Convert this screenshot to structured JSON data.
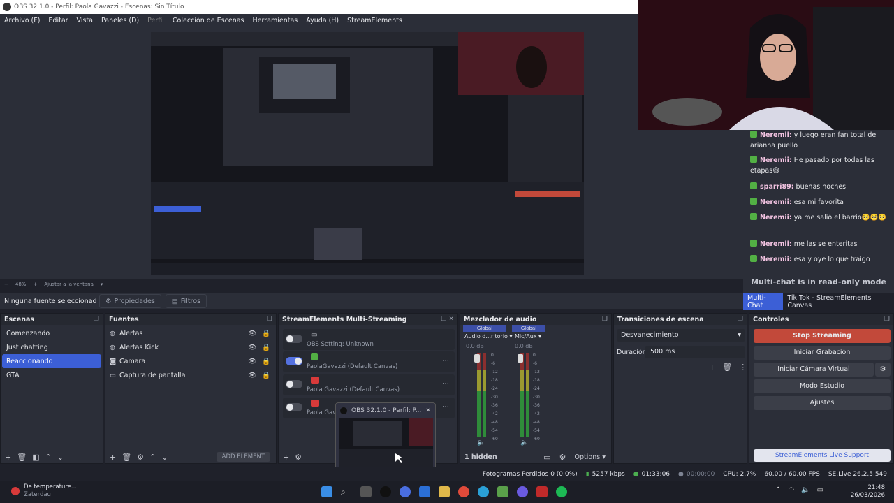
{
  "window": {
    "title": "OBS 32.1.0 - Perfil: Paola Gavazzi - Escenas: Sin Título"
  },
  "menu": [
    "Archivo (F)",
    "Editar",
    "Vista",
    "Paneles (D)",
    "Perfil",
    "Colección de Escenas",
    "Herramientas",
    "Ayuda (H)",
    "StreamElements"
  ],
  "zoom": {
    "level": "48%",
    "fit": "Ajustar a la ventana"
  },
  "propbar": {
    "no_source": "Ninguna fuente seleccionad",
    "properties": "Propiedades",
    "filters": "Filtros"
  },
  "chat": {
    "messages": [
      {
        "user": "Neremii:",
        "text": " y luego eran fan total de arianna puello"
      },
      {
        "user": "Neremii:",
        "text": " He pasado por todas las etapas😄"
      },
      {
        "user": "sparri89:",
        "text": " buenas noches"
      },
      {
        "user": "Neremii:",
        "text": " esa mi favorita"
      },
      {
        "user": "Neremii:",
        "text": " ya me salió el barrio🥺🥺🥺"
      },
      {
        "user": "Neremii:",
        "text": " me las se enteritas"
      },
      {
        "user": "Neremii:",
        "text": " esa y oye lo que traigo"
      }
    ],
    "readonly": "Multi-chat is in read-only mode",
    "tabs": [
      "Multi-Chat",
      "Tik Tok - StreamElements Canvas"
    ]
  },
  "scenes": {
    "title": "Escenas",
    "items": [
      "Comenzando",
      "Just chatting",
      "Reaccionando",
      "GTA"
    ],
    "selected": 2
  },
  "sources": {
    "title": "Fuentes",
    "items": [
      "Alertas",
      "Alertas Kick",
      "Camara",
      "Captura de pantalla"
    ],
    "add_element": "ADD ELEMENT"
  },
  "multistream": {
    "title": "StreamElements Multi-Streaming",
    "rows": [
      {
        "name": "OBS Setting: Unknown",
        "on": false
      },
      {
        "name": "PaolaGavazzi (Default Canvas)",
        "on": true
      },
      {
        "name": "Paola Gavazzi (Default Canvas)",
        "on": false
      },
      {
        "name": "Paola Gava",
        "on": false
      }
    ]
  },
  "mixer": {
    "title": "Mezclador de audio",
    "channels": [
      {
        "group": "Global",
        "name": "Audio d...ritorio",
        "db": "0.0 dB"
      },
      {
        "group": "Global",
        "name": "Mic/Aux",
        "db": "0.0 dB"
      }
    ],
    "scale": [
      "0",
      "-6",
      "-12",
      "-18",
      "-24",
      "-30",
      "-36",
      "-42",
      "-48",
      "-54",
      "-60"
    ],
    "hidden": "1 hidden",
    "options": "Options"
  },
  "transitions": {
    "title": "Transiciones de escena",
    "type": "Desvanecimiento",
    "duration_label": "Duración",
    "duration": "500 ms"
  },
  "controls": {
    "title": "Controles",
    "stop_streaming": "Stop Streaming",
    "start_recording": "Iniciar Grabación",
    "virtual_cam": "Iniciar Cámara Virtual",
    "studio_mode": "Modo Estudio",
    "settings": "Ajustes",
    "live_support": "StreamElements Live Support"
  },
  "status": {
    "dropped": "Fotogramas Perdidos 0 (0.0%)",
    "kbps": "5257 kbps",
    "live_time": "01:33:06",
    "rec_time": "00:00:00",
    "cpu": "CPU: 2.7%",
    "fps": "60.00 / 60.00 FPS",
    "version": "SE.Live 26.2.5.549"
  },
  "popup": {
    "title": "OBS 32.1.0 - Perfil: P..."
  },
  "taskbar": {
    "weather": "De temperature...",
    "day": "Zaterdag",
    "time": "21:48",
    "date": "26/03/2026"
  },
  "colors": {
    "accent": "#3c5fd6",
    "stop": "#c2493a",
    "kick": "#52b044"
  }
}
